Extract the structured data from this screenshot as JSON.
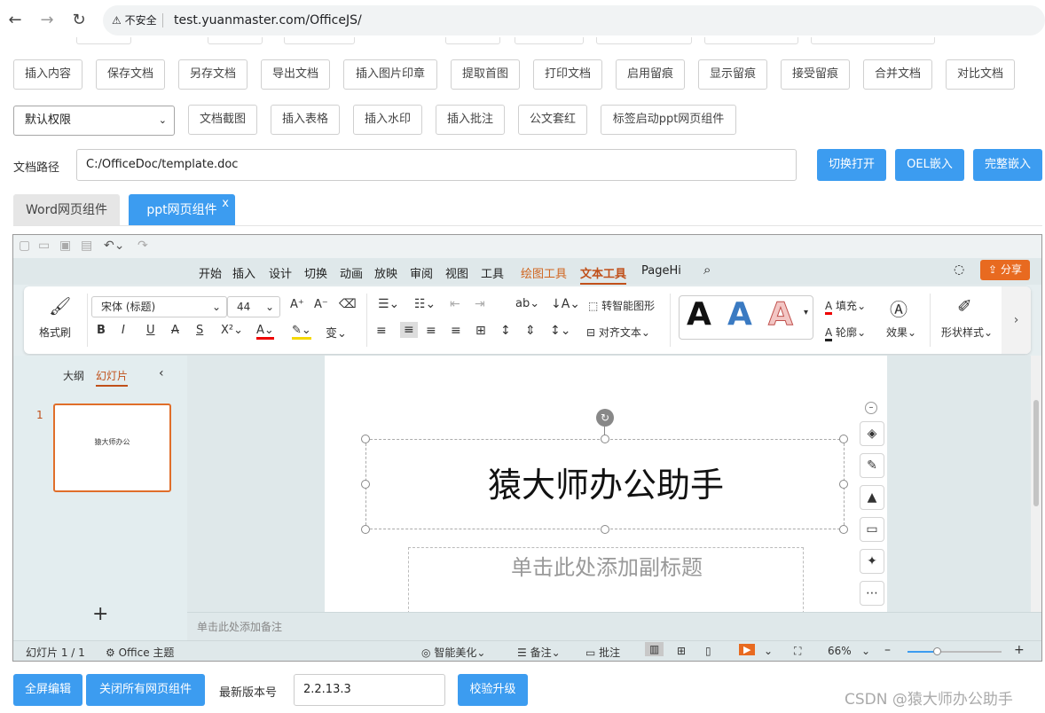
{
  "browser": {
    "back_icon": "←",
    "forward_icon": "→",
    "reload_icon": "↻",
    "security": "不安全",
    "url": "test.yuanmaster.com/OfficeJS/"
  },
  "toolbar": {
    "row1": [
      "插入内容",
      "保存文档",
      "另存文档",
      "导出文档",
      "插入图片印章",
      "提取首图",
      "打印文档",
      "启用留痕",
      "显示留痕",
      "接受留痕",
      "合并文档",
      "对比文档"
    ],
    "row2": [
      "文档截图",
      "插入表格",
      "插入水印",
      "插入批注",
      "公文套红",
      "标签启动ppt网页组件"
    ],
    "permission_select": "默认权限"
  },
  "path": {
    "label": "文档路径",
    "value": "C:/OfficeDoc/template.doc",
    "switch_open": "切换打开",
    "oel_embed": "OEL嵌入",
    "full_embed": "完整嵌入"
  },
  "tabs": {
    "word": "Word网页组件",
    "ppt": "ppt网页组件",
    "close": "x"
  },
  "wps": {
    "menu": [
      "开始",
      "插入",
      "设计",
      "切换",
      "动画",
      "放映",
      "审阅",
      "视图",
      "工具",
      "绘图工具",
      "文本工具",
      "PageHi"
    ],
    "share": "分享",
    "ribbon": {
      "format_painter": "格式刷",
      "font_name": "宋体 (标题)",
      "font_size": "44",
      "to_smartart": "转智能图形",
      "align_text": "对齐文本",
      "fill": "填充",
      "outline": "轮廓",
      "effect": "效果",
      "shape_style": "形状样式"
    },
    "sidebar": {
      "outline_tab": "大纲",
      "slides_tab": "幻灯片",
      "slide_number": "1",
      "thumb_title": "猿大师办公",
      "add": "+"
    },
    "slide": {
      "title": "猿大师办公助手",
      "subtitle_placeholder": "单击此处添加副标题"
    },
    "notes_placeholder": "单击此处添加备注",
    "status": {
      "slide_count": "幻灯片 1 / 1",
      "theme": "Office 主题",
      "beautify": "智能美化",
      "notes": "备注",
      "comments": "批注",
      "zoom": "66%"
    }
  },
  "footer": {
    "fullscreen": "全屏编辑",
    "close_all": "关闭所有网页组件",
    "version_label": "最新版本号",
    "version": "2.2.13.3",
    "verify_upgrade": "校验升级"
  },
  "watermark": "CSDN @猿大师办公助手",
  "colors": {
    "accent_blue": "#3c9cf0",
    "wps_orange": "#e86a20"
  }
}
